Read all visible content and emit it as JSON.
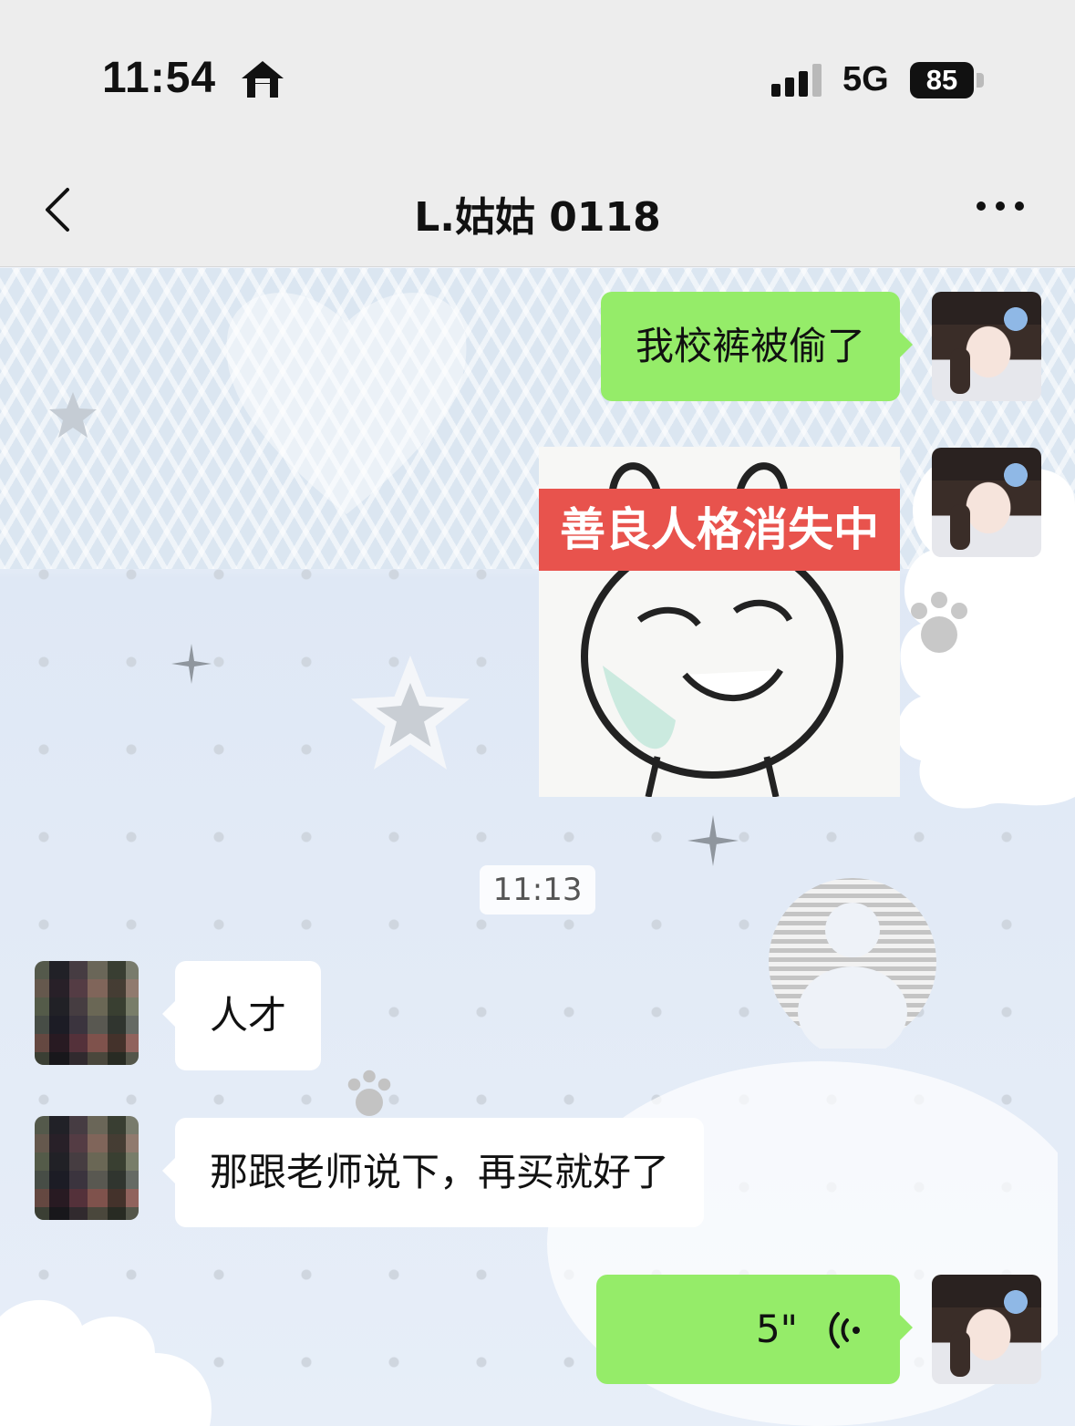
{
  "status_bar": {
    "time": "11:54",
    "network": "5G",
    "battery": "85",
    "icons": [
      "home-icon",
      "cellular-signal-icon",
      "battery-icon"
    ]
  },
  "nav": {
    "title": "L.姑姑 0118",
    "icons": [
      "back-chevron-icon",
      "more-options-icon"
    ]
  },
  "chat": {
    "messages": [
      {
        "from": "me",
        "type": "text",
        "text": "我校裤被偷了"
      },
      {
        "from": "me",
        "type": "sticker",
        "caption": "善良人格消失中"
      },
      {
        "type": "timestamp",
        "text": "11:13"
      },
      {
        "from": "friend",
        "type": "text",
        "text": "人才"
      },
      {
        "from": "friend",
        "type": "text",
        "text": "那跟老师说下，再买就好了"
      },
      {
        "from": "me",
        "type": "voice",
        "duration": "5\""
      }
    ]
  },
  "colors": {
    "outgoing_bubble": "#95ec69",
    "incoming_bubble": "#ffffff",
    "bar_background": "#ededed",
    "sticker_banner": "#e8534d"
  }
}
